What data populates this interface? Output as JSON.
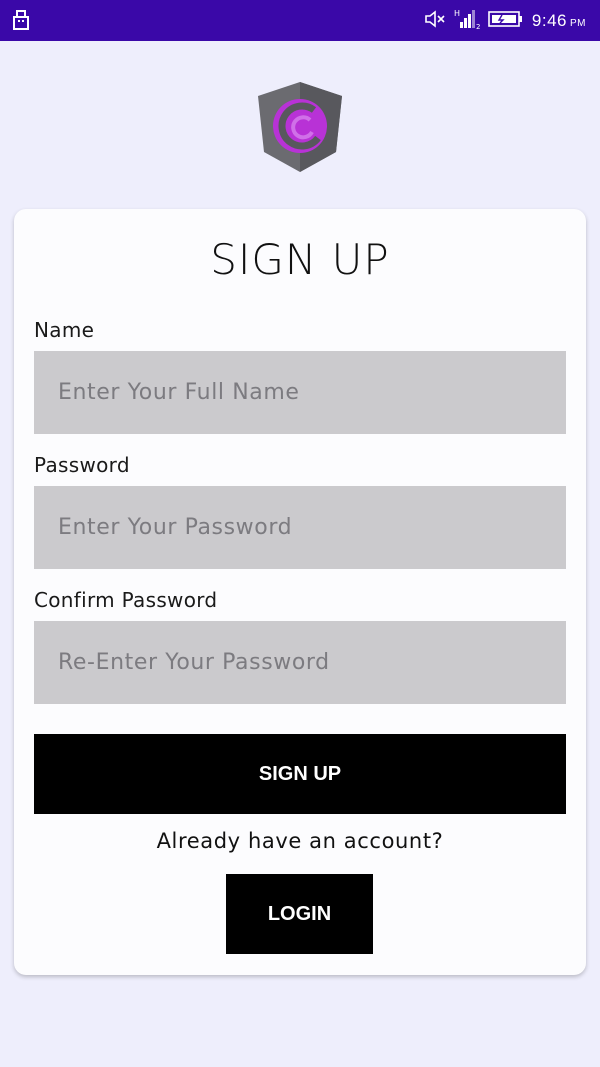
{
  "status_bar": {
    "time": "9:46",
    "ampm": "PM",
    "icons": [
      "usb-icon",
      "mute-icon",
      "signal-icon",
      "battery-icon"
    ]
  },
  "logo": {
    "name": "app-logo"
  },
  "form": {
    "title": "SIGN UP",
    "name_label": "Name",
    "name_placeholder": "Enter Your Full Name",
    "name_value": "",
    "password_label": "Password",
    "password_placeholder": "Enter Your Password",
    "password_value": "",
    "confirm_label": "Confirm Password",
    "confirm_placeholder": "Re-Enter Your Password",
    "confirm_value": "",
    "signup_button": "SIGN UP",
    "have_account": "Already have an account?",
    "login_button": "LOGIN"
  },
  "colors": {
    "status_bar": "#3a08a8",
    "background": "#eeeefc",
    "card": "#fcfcfe",
    "input": "#cbcacd",
    "button": "#000000",
    "logo_accent": "#b832d6"
  }
}
